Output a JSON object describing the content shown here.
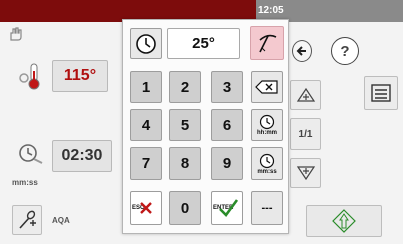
{
  "status_bar": {
    "time": "12:05"
  },
  "program": {
    "temperature": "115°",
    "duration": "02:30",
    "duration_unit": "mm:ss",
    "tool_label": "AQA"
  },
  "right_panel": {
    "step_counter": "1/1"
  },
  "keypad": {
    "display_value": "25°",
    "keys": [
      "1",
      "2",
      "3",
      "4",
      "5",
      "6",
      "7",
      "8",
      "9",
      "0"
    ],
    "hhmm_label": "hh:mm",
    "mmss_label": "mm:ss",
    "dashes_label": "---",
    "cancel_label": "ESC",
    "enter_label": "ENTER"
  },
  "colors": {
    "progress": "#7d0c0c",
    "warning_red": "#b01010",
    "confirm_green": "#2a8c2a",
    "selected_pink": "#f4c9cf"
  },
  "icons": [
    "hand-icon",
    "thermometer-icon",
    "timer-icon",
    "probe-icon",
    "clock-icon",
    "probe-pick-icon",
    "back-arrow-icon",
    "help-icon",
    "backspace-icon",
    "plus-triangle-icon",
    "notes-icon",
    "minus-triangle-icon",
    "start-diamond-icon"
  ]
}
